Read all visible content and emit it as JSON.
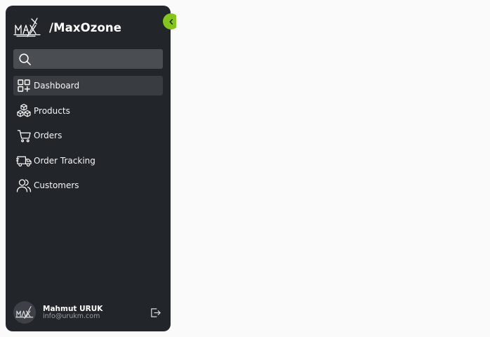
{
  "brand": {
    "name": "/MaxOzone",
    "logo_icon": "max-logo-icon"
  },
  "sidebar": {
    "collapse_icon": "chevron-left-icon",
    "search": {
      "value": "",
      "placeholder": "",
      "icon": "search-icon"
    },
    "items": [
      {
        "label": "Dashboard",
        "icon": "dashboard-grid-icon",
        "active": true
      },
      {
        "label": "Products",
        "icon": "boxes-icon",
        "active": false
      },
      {
        "label": "Orders",
        "icon": "shopping-cart-icon",
        "active": false
      },
      {
        "label": "Order Tracking",
        "icon": "delivery-truck-icon",
        "active": false
      },
      {
        "label": "Customers",
        "icon": "users-icon",
        "active": false
      }
    ]
  },
  "user": {
    "name": "Mahmut URUK",
    "email": "info@urukm.com",
    "avatar_icon": "avatar-logo-icon",
    "logout_icon": "logout-icon"
  },
  "colors": {
    "sidebar_bg": "#22262b",
    "accent": "#84c51c",
    "active_item_bg": "#393d42",
    "search_bg": "#4a4e53",
    "page_bg": "#fafafb"
  }
}
